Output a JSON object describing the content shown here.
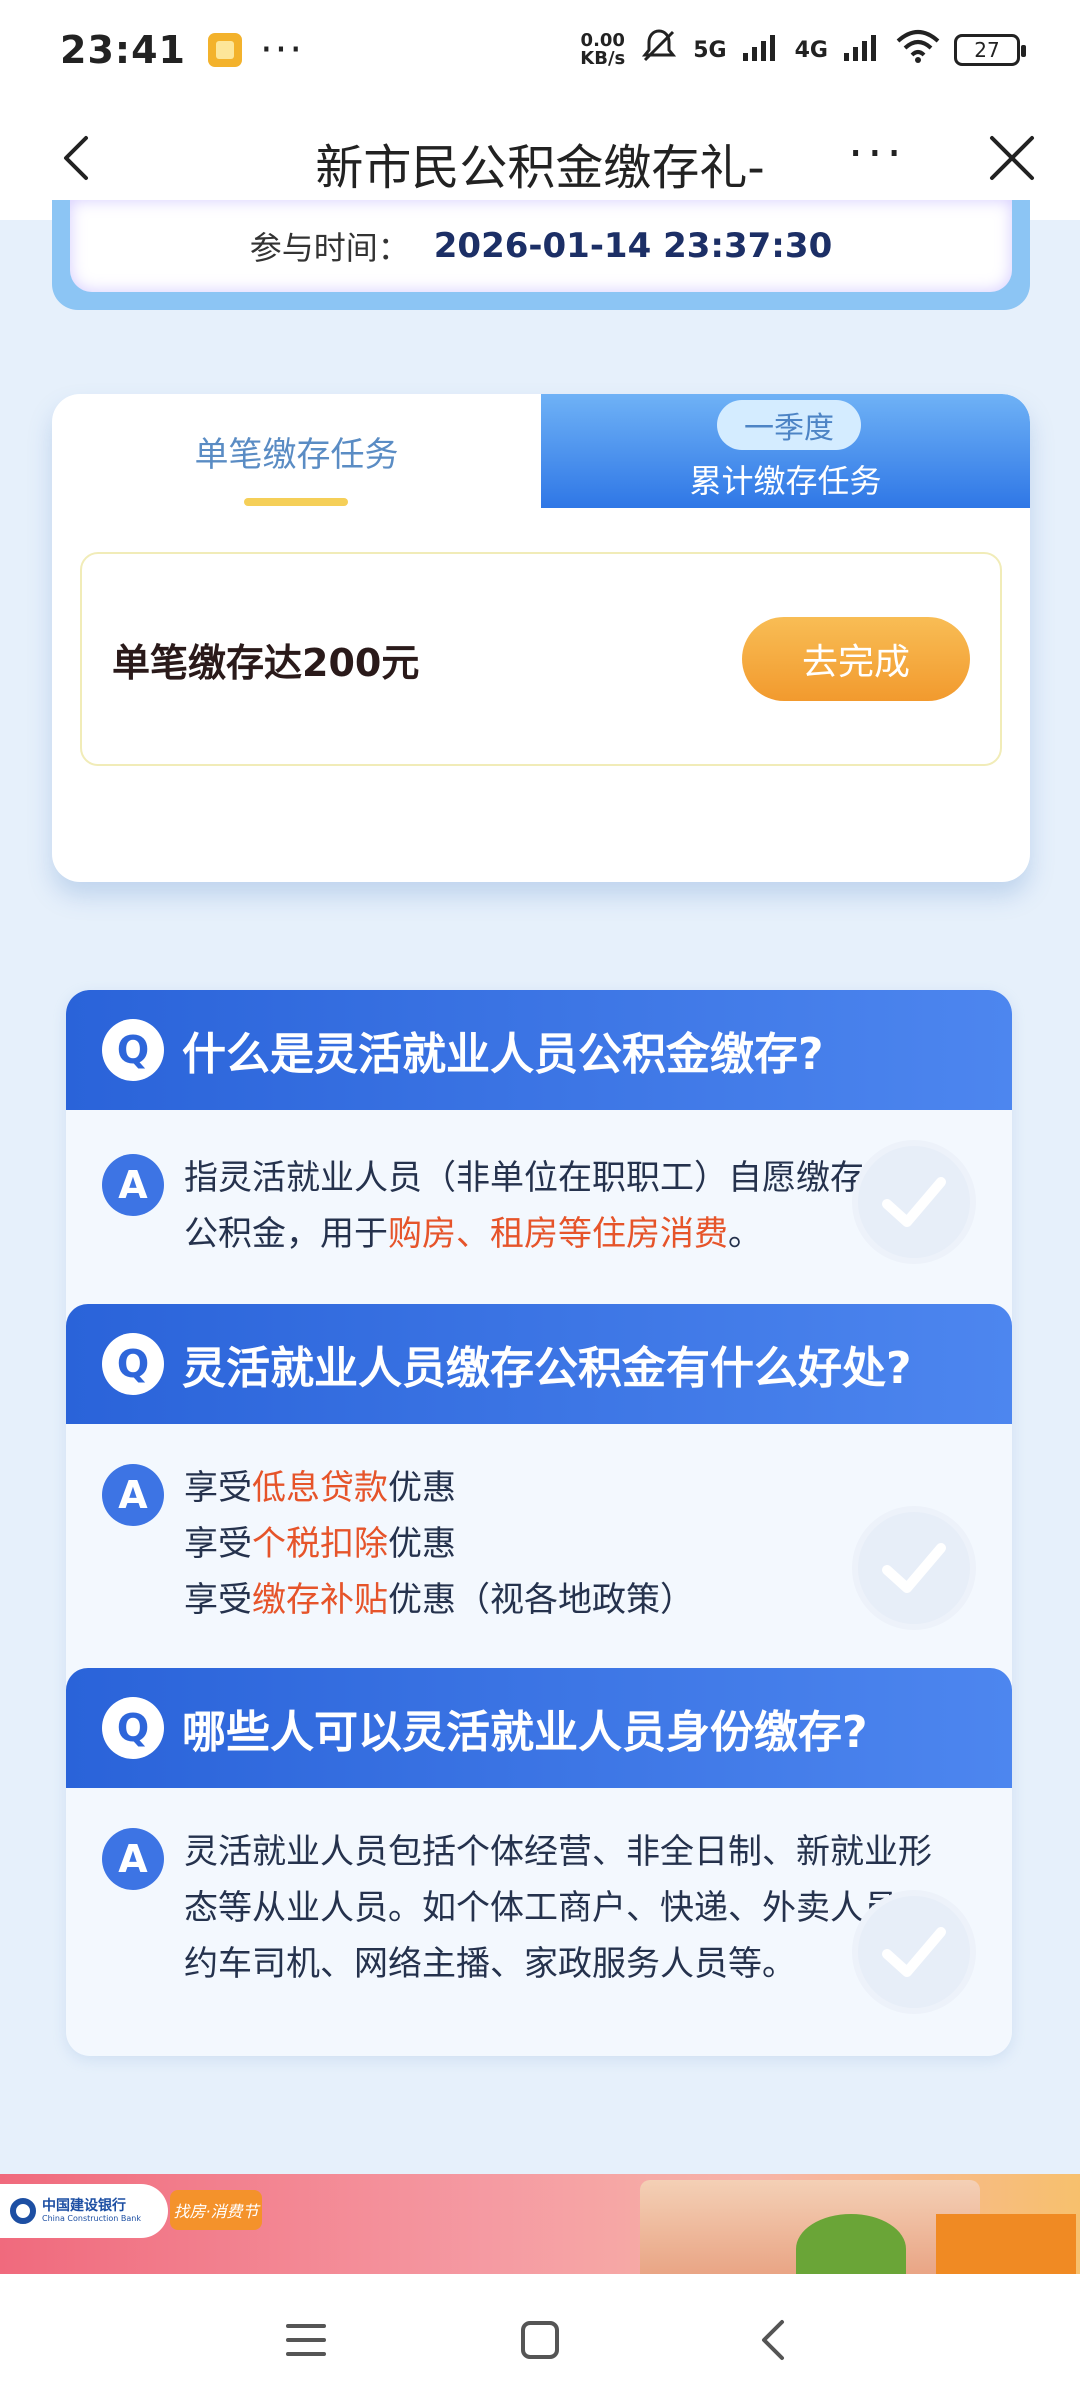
{
  "status_bar": {
    "time": "23:41",
    "more": "···",
    "net_speed_value": "0.00",
    "net_speed_unit": "KB/s",
    "signal_5g": "5G",
    "signal_4g": "4G",
    "battery": "27"
  },
  "nav": {
    "title": "新市民公积金缴存礼-",
    "more": "···"
  },
  "info": {
    "label": "参与时间：",
    "value": "2026-01-14 23:37:30"
  },
  "tabs": {
    "active": "单笔缴存任务",
    "inactive_badge": "一季度",
    "inactive": "累计缴存任务"
  },
  "task": {
    "text": "单笔缴存达200元",
    "button": "去完成"
  },
  "faq": {
    "q_badge": "Q",
    "a_badge": "A",
    "items": [
      {
        "question": "什么是灵活就业人员公积金缴存?",
        "answer_lines": [
          [
            "指灵活就业人员（非单位在职职工）自愿缴存住房"
          ],
          [
            "公积金，用于",
            "购房、租房等住房消费",
            "。"
          ]
        ]
      },
      {
        "question": "灵活就业人员缴存公积金有什么好处?",
        "answer_lines": [
          [
            "享受",
            "低息贷款",
            "优惠"
          ],
          [
            "享受",
            "个税扣除",
            "优惠"
          ],
          [
            "享受",
            "缴存补贴",
            "优惠（视各地政策）"
          ]
        ]
      },
      {
        "question": "哪些人可以灵活就业人员身份缴存?",
        "answer_lines": [
          [
            "灵活就业人员包括个体经营、非全日制、新就业形"
          ],
          [
            "态等从业人员。如个体工商户、快递、外卖人员网"
          ],
          [
            "约车司机、网络主播、家政服务人员等。"
          ]
        ]
      }
    ]
  },
  "banner": {
    "bank_name": "中国建设银行",
    "bank_name_en": "China Construction Bank",
    "tag": "找房·消费节"
  },
  "colors": {
    "accent_blue": "#2f77e6",
    "highlight": "#e6542a",
    "button_orange": "#f29a2e"
  }
}
